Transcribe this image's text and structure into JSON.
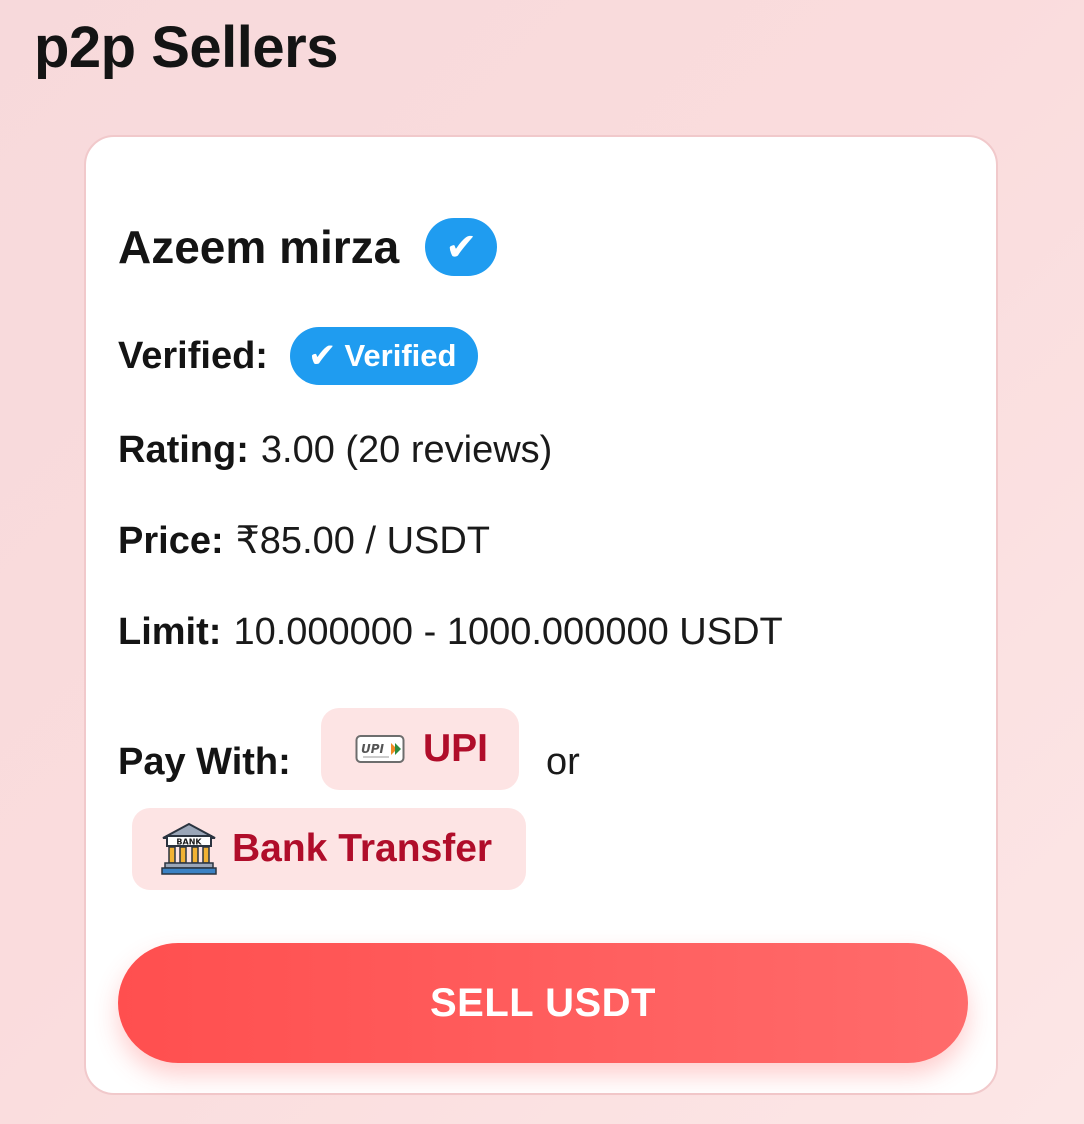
{
  "page": {
    "title": "p2p Sellers"
  },
  "seller": {
    "name": "Azeem mirza",
    "verified_icon": "✔",
    "verified_label": "Verified:",
    "verified_badge": "Verified",
    "rating_label": "Rating:",
    "rating_value": "3.00 (20 reviews)",
    "price_label": "Price:",
    "price_value": "₹85.00 / USDT",
    "limit_label": "Limit:",
    "limit_value": "10.000000 - 1000.000000 USDT"
  },
  "payment": {
    "label": "Pay With:",
    "methods": [
      {
        "name": "UPI",
        "icon": "upi-logo-icon"
      },
      {
        "name": "Bank Transfer",
        "icon": "bank-building-icon"
      }
    ],
    "separator": "or",
    "upi_logo_text": "UPI",
    "bank_sign_text": "BANK"
  },
  "actions": {
    "sell_label": "SELL USDT"
  },
  "colors": {
    "accent_blue": "#1f9cf0",
    "accent_red": "#ff5a5a",
    "chip_text": "#b00d2a",
    "chip_bg": "#fde4e4"
  }
}
